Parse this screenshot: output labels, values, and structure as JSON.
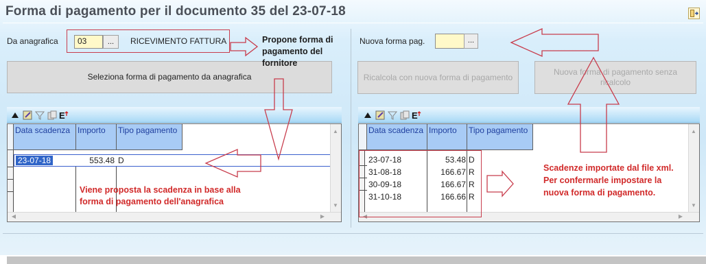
{
  "window": {
    "title": "Forma di pagamento per il documento 35 del 23-07-18"
  },
  "left_panel": {
    "anagrafica_label": "Da anagrafica",
    "anagrafica_code": "03",
    "lookup_button": "...",
    "payment_form_name": "RICEVIMENTO FATTURA",
    "select_button": "Seleziona forma di pagamento da anagrafica",
    "grid": {
      "columns": [
        "Data scadenza",
        "Importo",
        "Tipo pagamento"
      ],
      "rows": [
        {
          "date": "23-07-18",
          "amount": "553.48",
          "type": "D"
        }
      ]
    }
  },
  "right_panel": {
    "new_form_label": "Nuova forma pag.",
    "new_form_code": "",
    "lookup_button": "...",
    "recalc_button": "Ricalcola con nuova forma di pagamento",
    "no_recalc_button_line1": "Nuova forma di pagamento senza",
    "no_recalc_button_line2": "ricalcolo",
    "grid": {
      "columns": [
        "Data scadenza",
        "Importo",
        "Tipo pagamento"
      ],
      "rows": [
        {
          "date": "23-07-18",
          "amount": "53.48",
          "type": "D"
        },
        {
          "date": "31-08-18",
          "amount": "166.67",
          "type": "R"
        },
        {
          "date": "30-09-18",
          "amount": "166.67",
          "type": "R"
        },
        {
          "date": "31-10-18",
          "amount": "166.66",
          "type": "R"
        }
      ]
    }
  },
  "annotations": {
    "propone_line1": "Propone forma di",
    "propone_line2": "pagamento  del",
    "propone_line3": "fornitore",
    "viene_line1": "Viene proposta la scadenza in base alla",
    "viene_line2": "forma di pagamento dell'anagrafica",
    "scadenze_line1": "Scadenze importate dal file xml.",
    "scadenze_line2": "Per confermarle impostare la",
    "scadenze_line3": "nuova forma di pagamento."
  },
  "icons": {
    "exit": "exit-icon",
    "toolbar": [
      "arrow-up-icon",
      "edit-icon",
      "filter-icon",
      "copy-icon",
      "export-icon"
    ]
  },
  "colors": {
    "title": "#4a4f57",
    "annotation_red": "#d12a2a",
    "arrow_red": "#c83c4c",
    "input_yellow": "#fff9c9",
    "grid_header": "#a8cbf5"
  }
}
